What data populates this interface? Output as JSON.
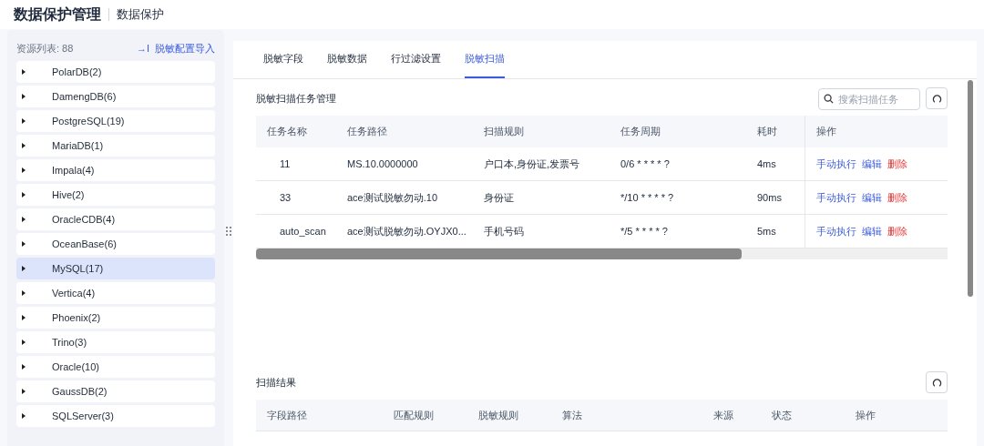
{
  "header": {
    "title": "数据保护管理",
    "subtitle": "数据保护"
  },
  "sidebar": {
    "count_label": "资源列表: 88",
    "import_link": "脱敏配置导入",
    "import_icon": "→I",
    "items": [
      {
        "label": "PolarDB(2)",
        "selected": false
      },
      {
        "label": "DamengDB(6)",
        "selected": false
      },
      {
        "label": "PostgreSQL(19)",
        "selected": false
      },
      {
        "label": "MariaDB(1)",
        "selected": false
      },
      {
        "label": "Impala(4)",
        "selected": false
      },
      {
        "label": "Hive(2)",
        "selected": false
      },
      {
        "label": "OracleCDB(4)",
        "selected": false
      },
      {
        "label": "OceanBase(6)",
        "selected": false
      },
      {
        "label": "MySQL(17)",
        "selected": true
      },
      {
        "label": "Vertica(4)",
        "selected": false
      },
      {
        "label": "Phoenix(2)",
        "selected": false
      },
      {
        "label": "Trino(3)",
        "selected": false
      },
      {
        "label": "Oracle(10)",
        "selected": false
      },
      {
        "label": "GaussDB(2)",
        "selected": false
      },
      {
        "label": "SQLServer(3)",
        "selected": false
      }
    ]
  },
  "tabs": [
    {
      "label": "脱敏字段",
      "selected": false
    },
    {
      "label": "脱敏数据",
      "selected": false
    },
    {
      "label": "行过滤设置",
      "selected": false
    },
    {
      "label": "脱敏扫描",
      "selected": true
    }
  ],
  "task_section": {
    "title": "脱敏扫描任务管理",
    "search": {
      "placeholder": "搜索扫描任务"
    },
    "columns": [
      "任务名称",
      "任务路径",
      "扫描规则",
      "任务周期",
      "耗时",
      "操作"
    ],
    "rows": [
      {
        "cells": [
          "11",
          "MS.10.0000000",
          "户口本,身份证,发票号",
          "0/6 * * * * ?",
          "4ms"
        ],
        "actions": [
          {
            "label": "手动执行",
            "kind": "run"
          },
          {
            "label": "编辑",
            "kind": "edit"
          },
          {
            "label": "删除",
            "kind": "delete"
          }
        ]
      },
      {
        "cells": [
          "33",
          "ace测试脱敏勿动.10",
          "身份证",
          "*/10 * * * * ?",
          "90ms"
        ],
        "actions": [
          {
            "label": "手动执行",
            "kind": "run"
          },
          {
            "label": "编辑",
            "kind": "edit"
          },
          {
            "label": "删除",
            "kind": "delete"
          }
        ]
      },
      {
        "cells": [
          "auto_scan",
          "ace测试脱敏勿动.OYJX0...",
          "手机号码",
          "*/5 * * * * ?",
          "5ms"
        ],
        "actions": [
          {
            "label": "手动执行",
            "kind": "run"
          },
          {
            "label": "编辑",
            "kind": "edit"
          },
          {
            "label": "删除",
            "kind": "delete"
          }
        ]
      }
    ]
  },
  "result_section": {
    "title": "扫描结果",
    "columns": [
      "字段路径",
      "匹配规则",
      "脱敏规则",
      "算法",
      "来源",
      "状态",
      "操作"
    ]
  }
}
